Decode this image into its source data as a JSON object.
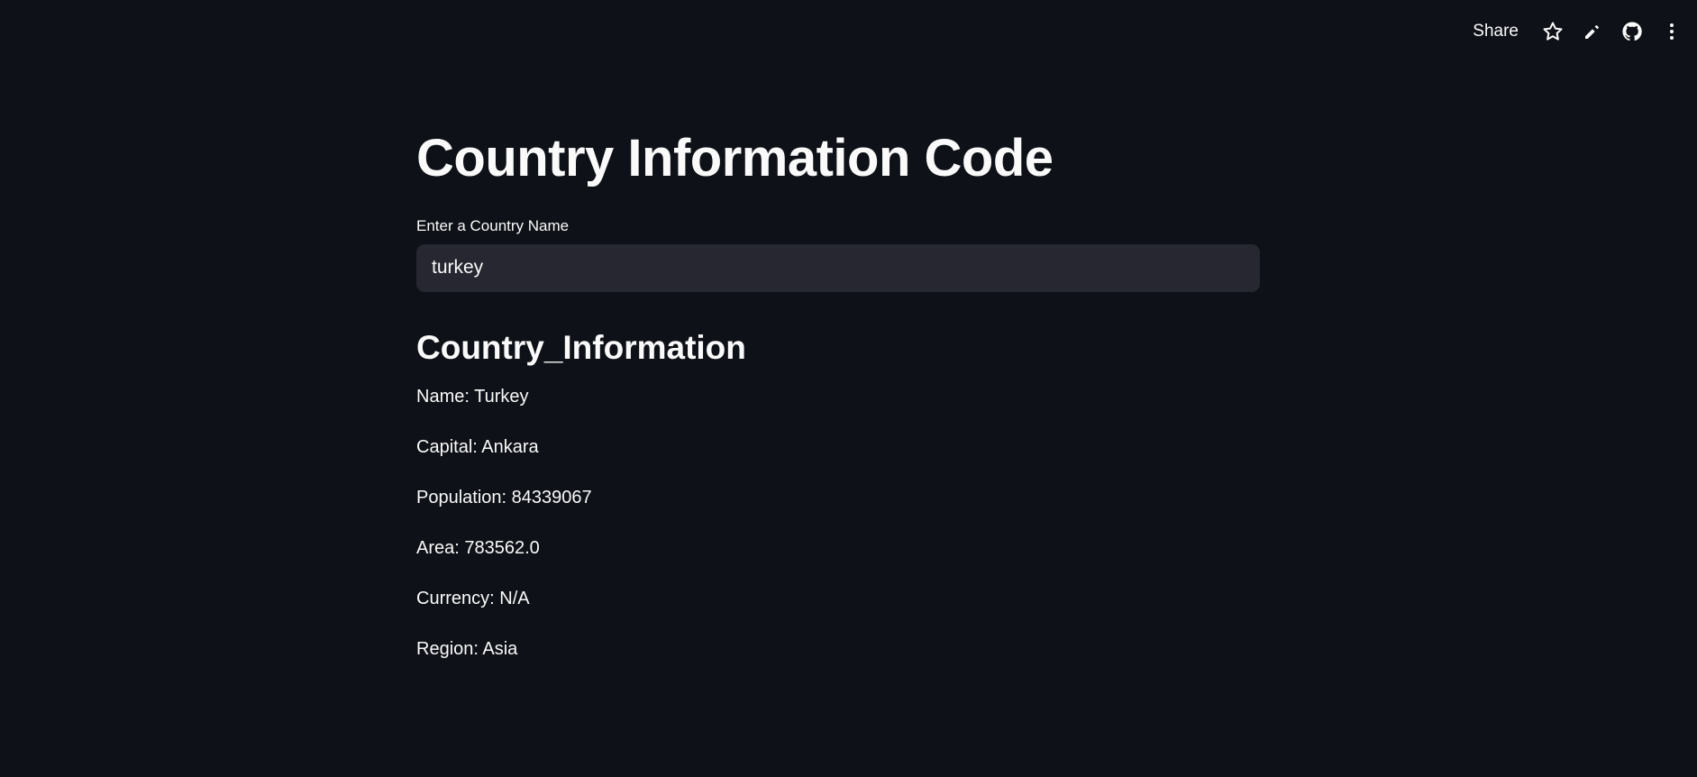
{
  "header": {
    "share_label": "Share",
    "icons": [
      "star-icon",
      "edit-icon",
      "github-icon",
      "more-icon"
    ]
  },
  "main": {
    "title": "Country Information Code",
    "input_label": "Enter a Country Name",
    "input_value": "turkey",
    "subheader": "Country_Information",
    "info": [
      "Name: Turkey",
      "Capital: Ankara",
      "Population: 84339067",
      "Area: 783562.0",
      "Currency: N/A",
      "Region: Asia"
    ]
  },
  "colors": {
    "background": "#0e1117",
    "text": "#fafafa",
    "input_background": "#262730"
  }
}
